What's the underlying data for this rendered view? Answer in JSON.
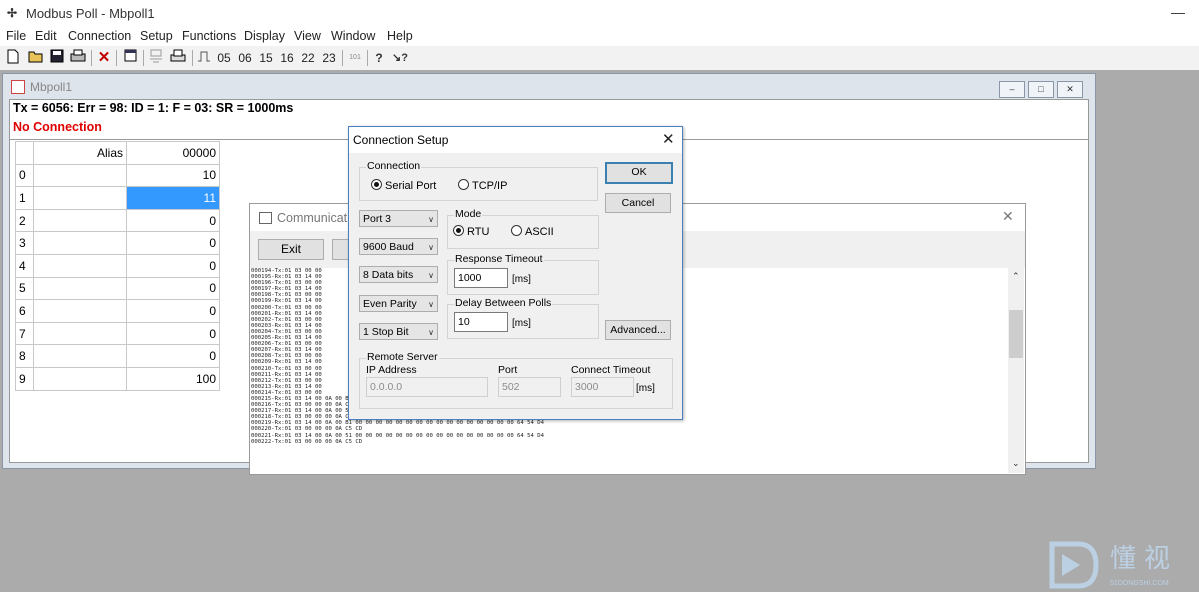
{
  "app": {
    "title": "Modbus Poll - Mbpoll1",
    "icon": "modbus-app-icon",
    "minimize_glyph": "—"
  },
  "menu": [
    "File",
    "Edit",
    "Connection",
    "Setup",
    "Functions",
    "Display",
    "View",
    "Window",
    "Help"
  ],
  "toolbar": {
    "icons": [
      "new-icon",
      "open-icon",
      "save-icon",
      "print-icon",
      "disconnect-icon",
      "window-icon",
      "connect-icon",
      "printer-icon",
      "pulse-icon"
    ],
    "function_codes": [
      "05",
      "06",
      "15",
      "16",
      "22",
      "23"
    ],
    "extra": "101",
    "help_glyph": "?",
    "context_help_glyph": "↘?",
    "disconnect_glyph": "✕"
  },
  "mbpoll": {
    "title": "Mbpoll1",
    "status": "Tx = 6056: Err = 98: ID = 1: F = 03: SR = 1000ms",
    "connection": "No Connection",
    "window_buttons": [
      "–",
      "□",
      "✕"
    ],
    "table": {
      "alias_header": "Alias",
      "value_header": "00000",
      "rows": [
        {
          "index": "0",
          "alias": "",
          "value": "10"
        },
        {
          "index": "1",
          "alias": "",
          "value": "11"
        },
        {
          "index": "2",
          "alias": "",
          "value": "0"
        },
        {
          "index": "3",
          "alias": "",
          "value": "0"
        },
        {
          "index": "4",
          "alias": "",
          "value": "0"
        },
        {
          "index": "5",
          "alias": "",
          "value": "0"
        },
        {
          "index": "6",
          "alias": "",
          "value": "0"
        },
        {
          "index": "7",
          "alias": "",
          "value": "0"
        },
        {
          "index": "8",
          "alias": "",
          "value": "0"
        },
        {
          "index": "9",
          "alias": "",
          "value": "100"
        }
      ],
      "selected_row": 1
    }
  },
  "comm": {
    "title": "Communication",
    "exit_label": "Exit",
    "close_glyph": "✕",
    "log": [
      "000194-Tx:01 03 00 00",
      "000195-Rx:01 03 14 00",
      "000196-Tx:01 03 00 00",
      "000197-Rx:01 03 14 00",
      "000198-Tx:01 03 00 00",
      "000199-Rx:01 03 14 00",
      "000200-Tx:01 03 00 00",
      "000201-Rx:01 03 14 00",
      "000202-Tx:01 03 00 00",
      "000203-Rx:01 03 14 00",
      "000204-Tx:01 03 00 00",
      "000205-Rx:01 03 14 00",
      "000206-Tx:01 03 00 00",
      "000207-Rx:01 03 14 00",
      "000208-Tx:01 03 00 00",
      "000209-Rx:01 03 14 00",
      "000210-Tx:01 03 00 00",
      "000211-Rx:01 03 14 00",
      "000212-Tx:01 03 00 00",
      "000213-Rx:01 03 14 00",
      "000214-Tx:01 03 00 00",
      "000215-Rx:01 03 14 00 0A 00 B1 00 00 00 00 00 00 00 00 00 00 00 00 00 00 00 00 64 54 D4",
      "000216-Tx:01 03 00 00 00 0A C5 CD",
      "000217-Rx:01 03 14 00 0A 00 51 00 00 00 00 00 00 00 00 00 00 00 00 00 00 00 00 64 54 D4",
      "000218-Tx:01 03 00 00 00 0A C5 CD",
      "000219-Rx:01 03 14 00 0A 00 B1 00 00 00 00 00 00 00 00 00 00 00 00 00 00 00 00 64 54 D4",
      "000220-Tx:01 03 00 00 00 0A C5 CD",
      "000221-Rx:01 03 14 00 0A 00 51 00 00 00 00 00 00 00 00 00 00 00 00 00 00 00 00 64 54 D4",
      "000222-Tx:01 03 00 00 00 0A C5 CD"
    ]
  },
  "dialog": {
    "title": "Connection Setup",
    "close_glyph": "✕",
    "connection_group": "Connection",
    "serial_port": "Serial Port",
    "tcp_ip": "TCP/IP",
    "connection_selected": "serial",
    "ok": "OK",
    "cancel": "Cancel",
    "port": "Port 3",
    "baud": "9600 Baud",
    "data_bits": "8 Data bits",
    "parity": "Even Parity",
    "stop_bits": "1 Stop Bit",
    "mode_group": "Mode",
    "rtu": "RTU",
    "ascii": "ASCII",
    "mode_selected": "rtu",
    "response_timeout_group": "Response Timeout",
    "response_timeout": "1000",
    "delay_group": "Delay Between Polls",
    "delay": "10",
    "ms_unit": "[ms]",
    "advanced": "Advanced...",
    "remote_group": "Remote Server",
    "ip_label": "IP Address",
    "ip_value": "0.0.0.0",
    "port_label": "Port",
    "port_value": "502",
    "connect_timeout_label": "Connect Timeout",
    "connect_timeout_value": "3000",
    "dropdown_arrow": "∨"
  },
  "watermark": {
    "text": "懂视",
    "sub": "51DONGSHI.COM"
  },
  "colors": {
    "selection": "#3399ff",
    "error_text": "#e00000",
    "mdi_background": "#ababab",
    "dialog_border": "#4a7fc1"
  }
}
